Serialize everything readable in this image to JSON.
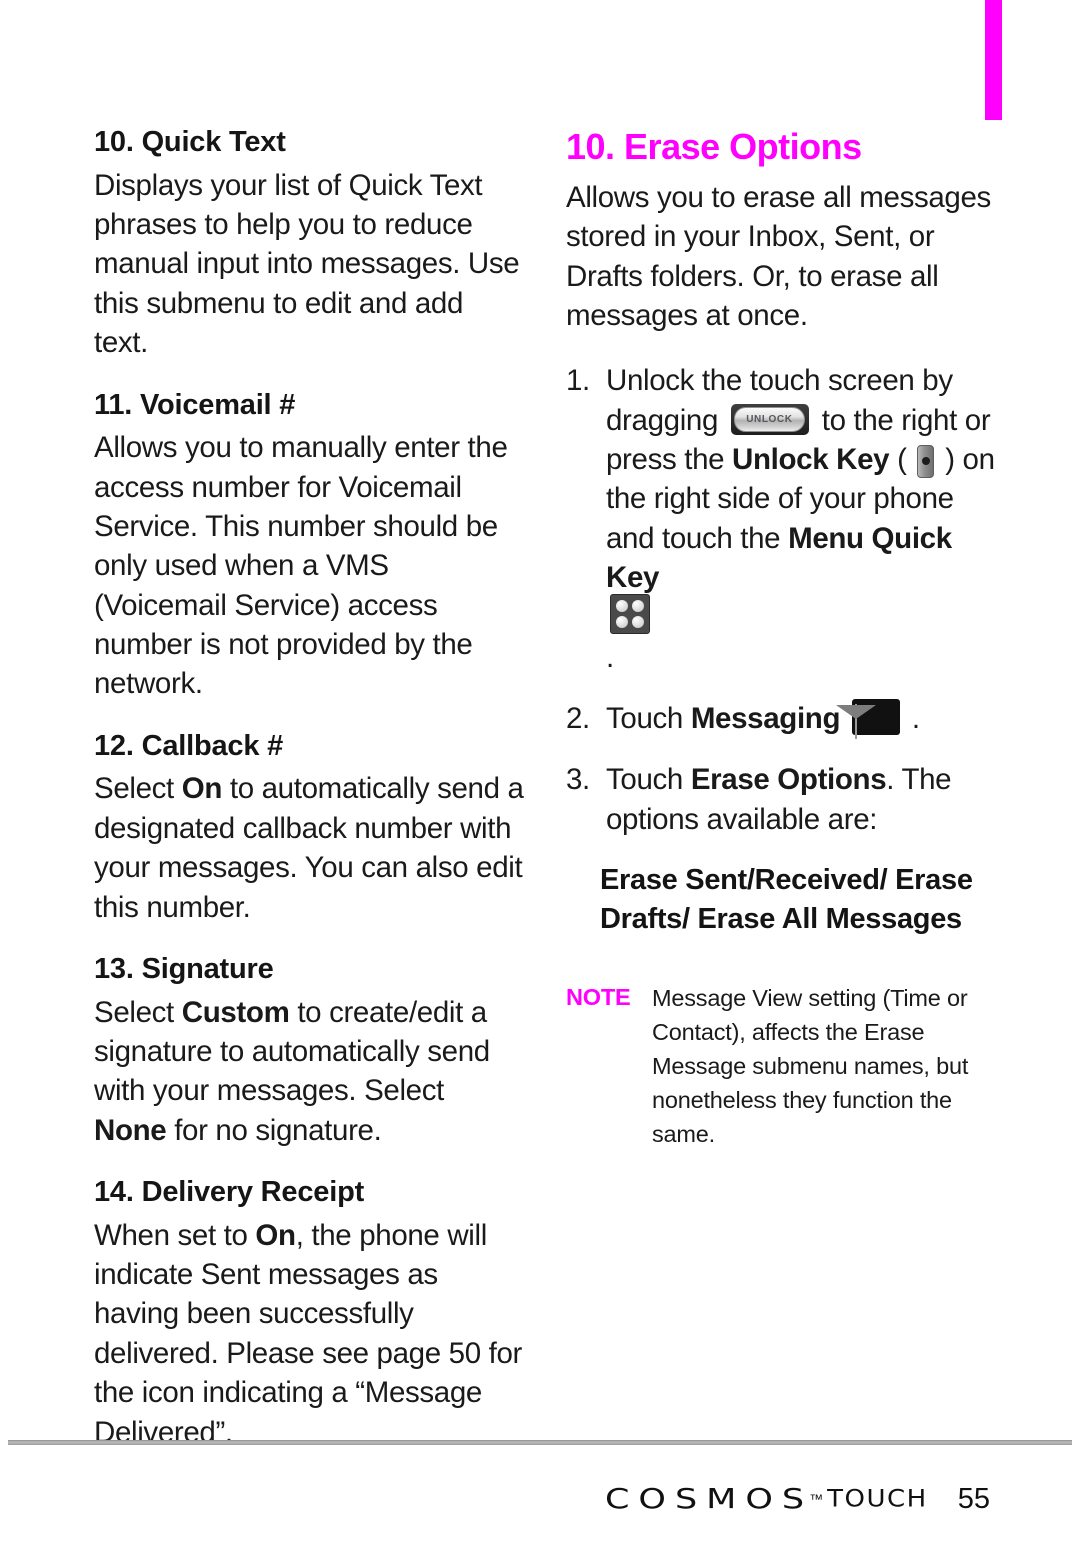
{
  "page": {
    "number": "55",
    "tab_marker_color": "#ff00ff",
    "accent_color": "#ff00ff"
  },
  "left_column": {
    "sections": [
      {
        "heading": "10. Quick Text",
        "paragraph_parts": [
          {
            "text": "Displays your list of Quick Text phrases to help you to reduce manual input into messages. Use this submenu to edit and add text.",
            "bold": false
          }
        ]
      },
      {
        "heading": "11. Voicemail #",
        "paragraph_parts": [
          {
            "text": "Allows you to manually enter the access number for Voicemail Service. This number should be only used when a VMS (Voicemail Service) access number is not provided by the network.",
            "bold": false
          }
        ]
      },
      {
        "heading": "12. Callback #",
        "paragraph_parts": [
          {
            "text": "Select ",
            "bold": false
          },
          {
            "text": "On",
            "bold": true
          },
          {
            "text": " to automatically send a designated callback number with your messages. You can also edit this number.",
            "bold": false
          }
        ]
      },
      {
        "heading": "13. Signature",
        "paragraph_parts": [
          {
            "text": "Select ",
            "bold": false
          },
          {
            "text": "Custom",
            "bold": true
          },
          {
            "text": " to create/edit a signature to automatically send with your messages. Select ",
            "bold": false
          },
          {
            "text": "None",
            "bold": true
          },
          {
            "text": " for no signature.",
            "bold": false
          }
        ]
      },
      {
        "heading": "14. Delivery Receipt",
        "paragraph_parts": [
          {
            "text": "When set to ",
            "bold": false
          },
          {
            "text": "On",
            "bold": true
          },
          {
            "text": ", the phone will indicate Sent messages as having been successfully delivered. Please see page 50 for the icon indicating a “Message Delivered”.",
            "bold": false
          }
        ]
      }
    ]
  },
  "right_column": {
    "heading": "10. Erase Options",
    "intro": "Allows you to erase all messages stored in your Inbox, Sent, or Drafts folders. Or, to erase all messages at once.",
    "steps": [
      {
        "number": "1.",
        "parts": [
          {
            "text": "Unlock the touch screen by dragging ",
            "bold": false
          },
          {
            "icon": "unlock-slider-icon",
            "label": "UNLOCK"
          },
          {
            "text": " to the right or press the ",
            "bold": false
          },
          {
            "text": "Unlock Key",
            "bold": true
          },
          {
            "text": " ( ",
            "bold": false
          },
          {
            "icon": "unlock-side-key-icon"
          },
          {
            "text": " ) on the right side of your phone and touch the ",
            "bold": false
          },
          {
            "text": "Menu Quick Key",
            "bold": true
          },
          {
            "text": " ",
            "bold": false
          },
          {
            "icon": "menu-quick-key-icon"
          },
          {
            "text": " .",
            "bold": false
          }
        ]
      },
      {
        "number": "2.",
        "parts": [
          {
            "text": "Touch ",
            "bold": false
          },
          {
            "text": "Messaging",
            "bold": true
          },
          {
            "text": " ",
            "bold": false
          },
          {
            "icon": "messaging-envelope-icon"
          },
          {
            "text": " .",
            "bold": false
          }
        ]
      },
      {
        "number": "3.",
        "parts": [
          {
            "text": "Touch ",
            "bold": false
          },
          {
            "text": "Erase Options",
            "bold": true
          },
          {
            "text": ". The options available are:",
            "bold": false
          }
        ]
      }
    ],
    "options_list": "Erase Sent/Received/ Erase Drafts/ Erase All Messages",
    "note": {
      "label": "NOTE",
      "text": "Message View setting (Time or Contact), affects the Erase Message submenu names, but nonetheless they function the same."
    }
  },
  "footer": {
    "brand": "COSMOS",
    "trademark": "™",
    "product": "TOUCH",
    "page_number": "55"
  }
}
